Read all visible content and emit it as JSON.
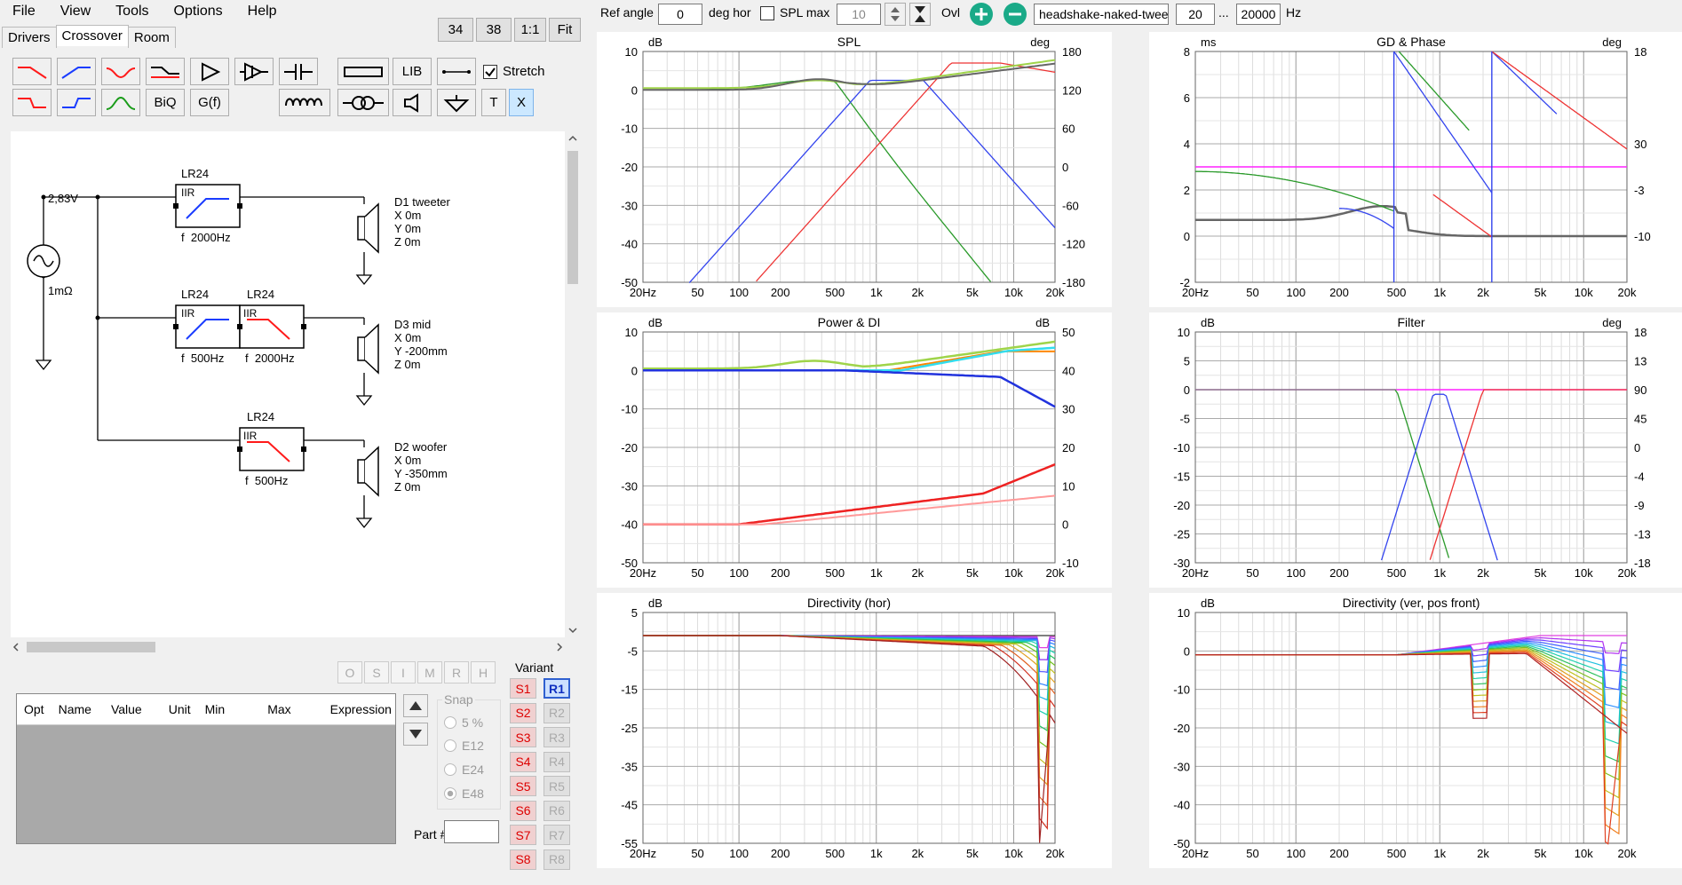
{
  "menu": [
    "File",
    "View",
    "Tools",
    "Options",
    "Help"
  ],
  "tabs": [
    "Drivers",
    "Crossover",
    "Room"
  ],
  "zoom_buttons": [
    "34",
    "38",
    "1:1",
    "Fit"
  ],
  "toolbar": {
    "lib": "LIB",
    "biq": "BiQ",
    "gf": "G(f)",
    "t": "T",
    "x": "X",
    "stretch": "Stretch"
  },
  "schematic": {
    "source_voltage": "2,83V",
    "source_res": "1mΩ",
    "filters": [
      {
        "type": "LR24",
        "kind": "IIR",
        "freq": "f  2000Hz"
      },
      {
        "type": "LR24",
        "kind": "IIR",
        "freq": "f  500Hz"
      },
      {
        "type": "LR24",
        "kind": "IIR",
        "freq": "f  2000Hz"
      },
      {
        "type": "LR24",
        "kind": "IIR",
        "freq": "f  500Hz"
      }
    ],
    "drivers": [
      {
        "name": "D1 tweeter",
        "x": "X 0m",
        "y": "Y 0m",
        "z": "Z 0m"
      },
      {
        "name": "D3 mid",
        "x": "X 0m",
        "y": "Y -200mm",
        "z": "Z 0m"
      },
      {
        "name": "D2 woofer",
        "x": "X 0m",
        "y": "Y -350mm",
        "z": "Z 0m"
      }
    ]
  },
  "opt_buttons": [
    "O",
    "S",
    "I",
    "M",
    "R",
    "H"
  ],
  "table_headers": [
    "Opt",
    "Name",
    "Value",
    "Unit",
    "Min",
    "Max",
    "Expression"
  ],
  "snap": {
    "label": "Snap",
    "options": [
      "5 %",
      "E12",
      "E24",
      "E48"
    ]
  },
  "variant": {
    "label": "Variant",
    "s": [
      "S1",
      "S2",
      "S3",
      "S4",
      "S5",
      "S6",
      "S7",
      "S8"
    ],
    "r": [
      "R1",
      "R2",
      "R3",
      "R4",
      "R5",
      "R6",
      "R7",
      "R8"
    ]
  },
  "part_label": "Part #",
  "topbar": {
    "ref_angle_label": "Ref angle",
    "ref_angle": "0",
    "deg_hor": "deg hor",
    "spl_max": "SPL max",
    "spl_max_value": "10",
    "ovl": "Ovl",
    "overlay_name": "headshake-naked-tweet",
    "f_min": "20",
    "dots": "...",
    "f_max": "20000",
    "hz": "Hz"
  },
  "charts": [
    {
      "title": "SPL",
      "ylabel": "dB",
      "y2label": "deg",
      "yticks": [
        "10",
        "0",
        "-10",
        "-20",
        "-30",
        "-40",
        "-50"
      ],
      "y2ticks": [
        "180",
        "120",
        "60",
        "0",
        "-60",
        "-120",
        "-180"
      ]
    },
    {
      "title": "GD & Phase",
      "ylabel": "ms",
      "y2label": "deg",
      "yticks": [
        "8",
        "6",
        "4",
        "2",
        "0",
        "-2"
      ],
      "y2ticks": [
        "18",
        "",
        "30",
        "-3",
        "-10",
        ""
      ]
    },
    {
      "title": "Power & DI",
      "ylabel": "dB",
      "y2label": "dB",
      "yticks": [
        "10",
        "0",
        "-10",
        "-20",
        "-30",
        "-40",
        "-50"
      ],
      "y2ticks": [
        "50",
        "40",
        "30",
        "20",
        "10",
        "0",
        "-10"
      ]
    },
    {
      "title": "Filter",
      "ylabel": "dB",
      "y2label": "deg",
      "yticks": [
        "10",
        "5",
        "0",
        "-5",
        "-10",
        "-15",
        "-20",
        "-25",
        "-30"
      ],
      "y2ticks": [
        "18",
        "13",
        "90",
        "45",
        "0",
        "-4",
        "-9",
        "-13",
        "-18"
      ]
    },
    {
      "title": "Directivity (hor)",
      "ylabel": "dB",
      "y2label": "",
      "yticks": [
        "5",
        "-5",
        "-15",
        "-25",
        "-35",
        "-45",
        "-55"
      ],
      "y2ticks": []
    },
    {
      "title": "Directivity (ver, pos front)",
      "ylabel": "dB",
      "y2label": "",
      "yticks": [
        "10",
        "0",
        "-10",
        "-20",
        "-30",
        "-40",
        "-50"
      ],
      "y2ticks": []
    }
  ],
  "xticks": [
    "20Hz",
    "50",
    "100",
    "200",
    "500",
    "1k",
    "2k",
    "5k",
    "10k",
    "20k"
  ],
  "colors": {
    "highpass": "#1a3cff",
    "lowpass": "#ff1a1a",
    "bandpass": "#1a9c1a",
    "selected": "#cce8ff"
  }
}
